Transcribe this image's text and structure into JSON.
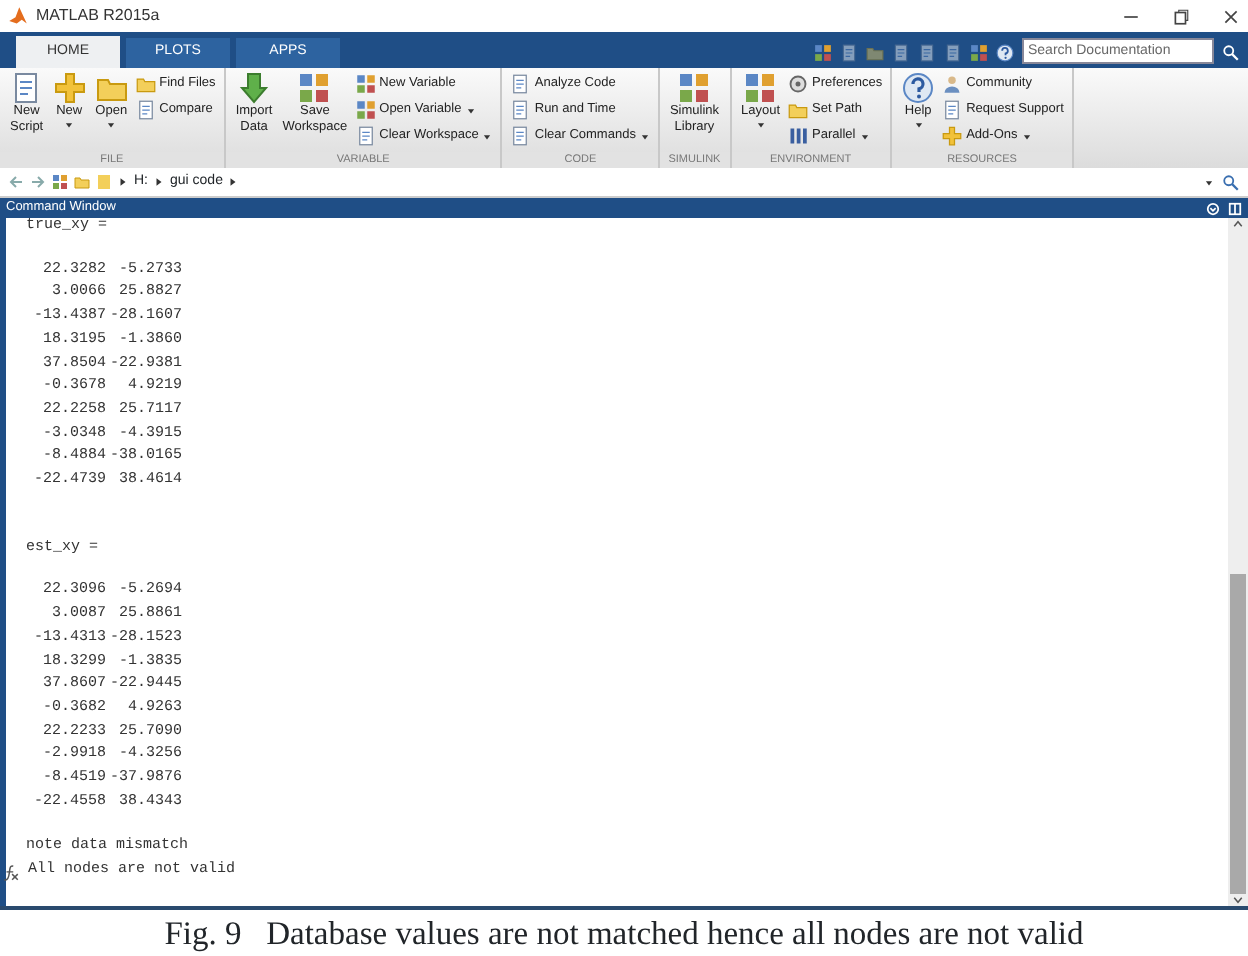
{
  "window": {
    "title": "MATLAB R2015a"
  },
  "tabs": [
    {
      "label": "HOME",
      "selected": true
    },
    {
      "label": "PLOTS",
      "selected": false
    },
    {
      "label": "APPS",
      "selected": false
    }
  ],
  "search": {
    "placeholder": "Search Documentation"
  },
  "ribbon": [
    {
      "label": "FILE",
      "items": [
        {
          "kind": "large",
          "label": "New\nScript",
          "dropdown": false
        },
        {
          "kind": "large",
          "label": "New",
          "dropdown": true
        },
        {
          "kind": "large",
          "label": "Open",
          "dropdown": true
        },
        {
          "kind": "small",
          "label": "Find Files",
          "dropdown": false
        },
        {
          "kind": "small",
          "label": "Compare",
          "dropdown": false
        }
      ]
    },
    {
      "label": "VARIABLE",
      "items": [
        {
          "kind": "large",
          "label": "Import\nData",
          "dropdown": false
        },
        {
          "kind": "large",
          "label": "Save\nWorkspace",
          "dropdown": false
        },
        {
          "kind": "small",
          "label": "New Variable",
          "dropdown": false
        },
        {
          "kind": "small",
          "label": "Open Variable",
          "dropdown": true
        },
        {
          "kind": "small",
          "label": "Clear Workspace",
          "dropdown": true
        }
      ]
    },
    {
      "label": "CODE",
      "items": [
        {
          "kind": "small",
          "label": "Analyze Code",
          "dropdown": false
        },
        {
          "kind": "small",
          "label": "Run and Time",
          "dropdown": false
        },
        {
          "kind": "small",
          "label": "Clear Commands",
          "dropdown": true
        }
      ]
    },
    {
      "label": "SIMULINK",
      "items": [
        {
          "kind": "large",
          "label": "Simulink\nLibrary",
          "dropdown": false
        }
      ]
    },
    {
      "label": "ENVIRONMENT",
      "items": [
        {
          "kind": "large",
          "label": "Layout",
          "dropdown": true
        },
        {
          "kind": "small",
          "label": "Preferences",
          "dropdown": false
        },
        {
          "kind": "small",
          "label": "Set Path",
          "dropdown": false
        },
        {
          "kind": "small",
          "label": "Parallel",
          "dropdown": true
        }
      ]
    },
    {
      "label": "RESOURCES",
      "items": [
        {
          "kind": "large",
          "label": "Help",
          "dropdown": true
        },
        {
          "kind": "small",
          "label": "Community",
          "dropdown": false
        },
        {
          "kind": "small",
          "label": "Request Support",
          "dropdown": false
        },
        {
          "kind": "small",
          "label": "Add-Ons",
          "dropdown": true
        }
      ]
    }
  ],
  "address": {
    "path": [
      "H:",
      "gui code"
    ]
  },
  "command_window": {
    "title": "Command Window",
    "blocks": [
      {
        "kind": "label",
        "text": "true_xy ="
      },
      {
        "kind": "matrix",
        "rows": [
          [
            "22.3282",
            "-5.2733"
          ],
          [
            "3.0066",
            "25.8827"
          ],
          [
            "-13.4387",
            "-28.1607"
          ],
          [
            "18.3195",
            "-1.3860"
          ],
          [
            "37.8504",
            "-22.9381"
          ],
          [
            "-0.3678",
            "4.9219"
          ],
          [
            "22.2258",
            "25.7117"
          ],
          [
            "-3.0348",
            "-4.3915"
          ],
          [
            "-8.4884",
            "-38.0165"
          ],
          [
            "-22.4739",
            "38.4614"
          ]
        ]
      },
      {
        "kind": "label",
        "text": "est_xy ="
      },
      {
        "kind": "matrix",
        "rows": [
          [
            "22.3096",
            "-5.2694"
          ],
          [
            "3.0087",
            "25.8861"
          ],
          [
            "-13.4313",
            "-28.1523"
          ],
          [
            "18.3299",
            "-1.3835"
          ],
          [
            "37.8607",
            "-22.9445"
          ],
          [
            "-0.3682",
            "4.9263"
          ],
          [
            "22.2233",
            "25.7090"
          ],
          [
            "-2.9918",
            "-4.3256"
          ],
          [
            "-8.4519",
            "-37.9876"
          ],
          [
            "-22.4558",
            "38.4343"
          ]
        ]
      },
      {
        "kind": "text",
        "text": "note data mismatch"
      },
      {
        "kind": "prompt",
        "text": "All nodes are not valid"
      }
    ]
  },
  "caption": "Fig. 9   Database values are not matched hence all nodes are not valid"
}
